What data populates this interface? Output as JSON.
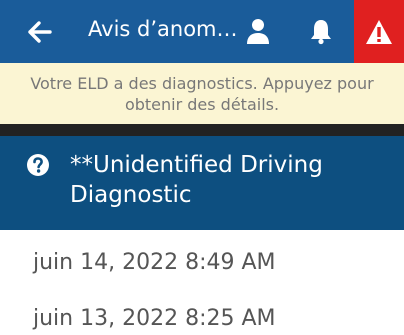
{
  "header": {
    "title": "Avis d’anom…",
    "icons": [
      "back-arrow-icon",
      "user-icon",
      "bell-icon",
      "warning-triangle-icon"
    ],
    "colors": {
      "bar": "#1a5c9a",
      "alert": "#e02020"
    }
  },
  "banner": {
    "text": "Votre ELD a des diagnostics. Appuyez pour obtenir des détails.",
    "color": "#fbf5d3"
  },
  "diagnostic": {
    "title": "**Unidentified Driving Diagnostic",
    "icon": "question-circle-icon",
    "color": "#0d4f80"
  },
  "entries": [
    {
      "timestamp": "juin 14, 2022 8:49 AM"
    },
    {
      "timestamp": "juin 13, 2022 8:25 AM"
    }
  ]
}
